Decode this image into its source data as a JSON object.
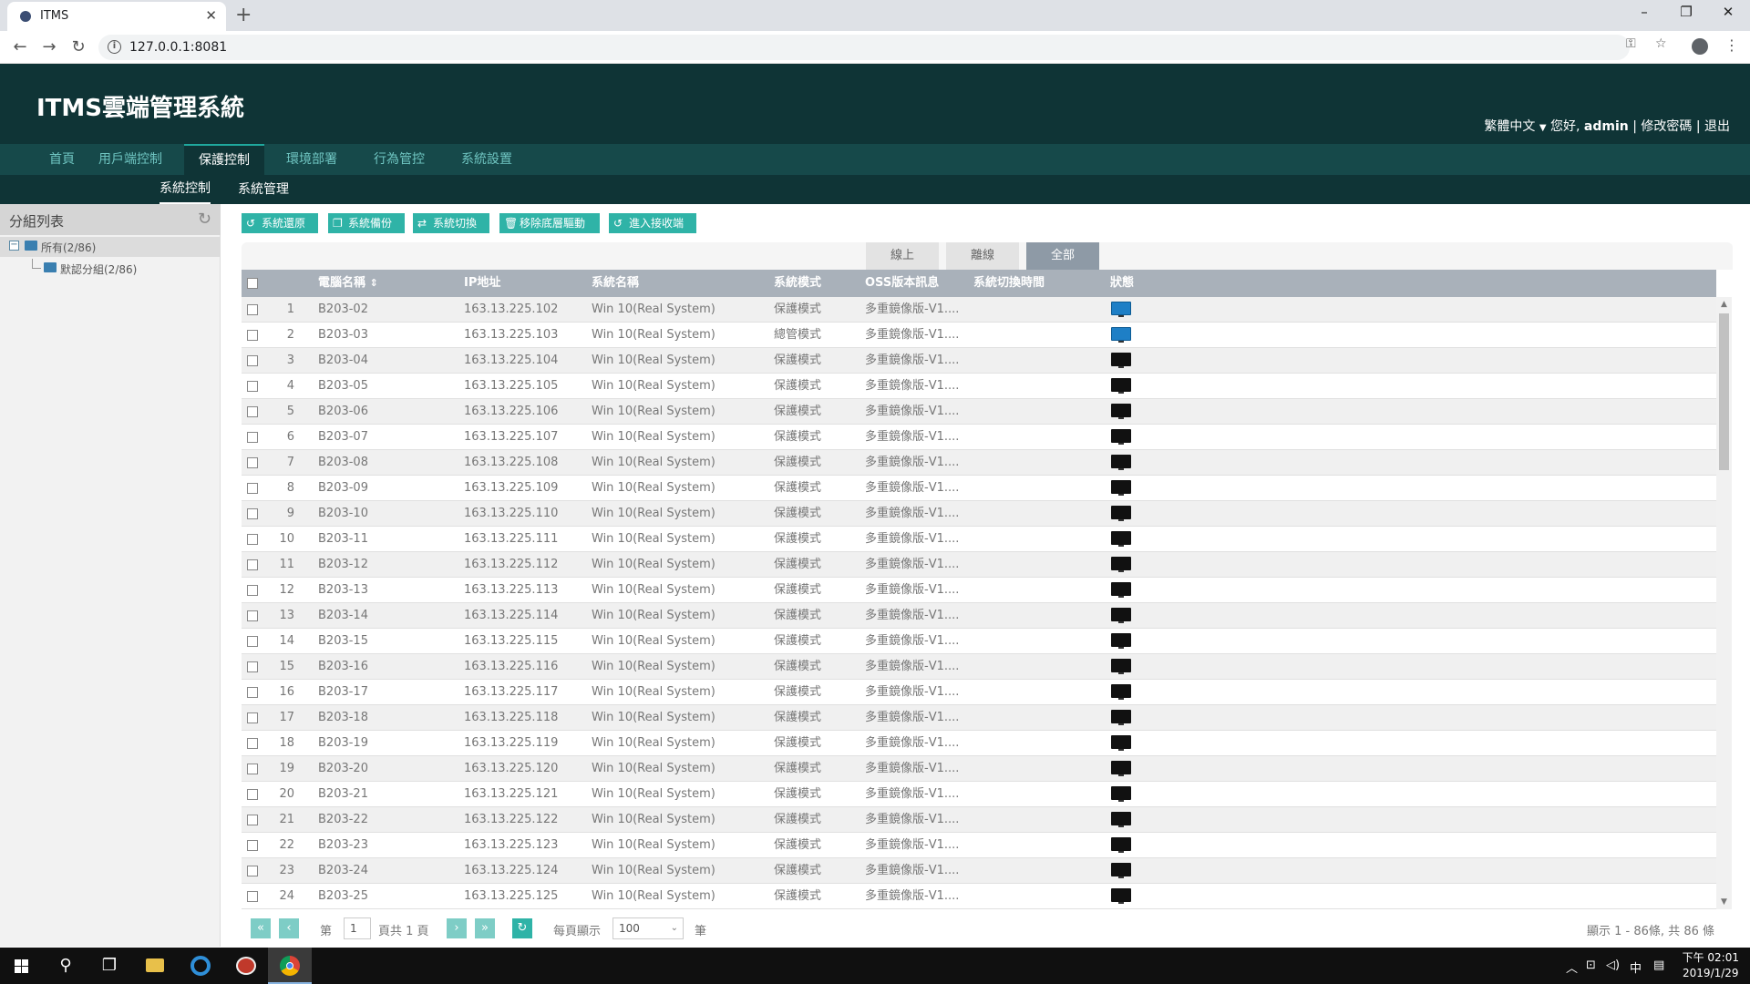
{
  "browser": {
    "tab_title": "ITMS",
    "url": "127.0.0.1:8081"
  },
  "app": {
    "title": "ITMS雲端管理系統",
    "user": {
      "language": "繁體中文",
      "greeting": "您好,",
      "username": "admin",
      "change_password": "修改密碼",
      "logout": "退出",
      "sep": "|"
    }
  },
  "mainnav": [
    "首頁",
    "用戶端控制",
    "保護控制",
    "環境部署",
    "行為管控",
    "系統設置"
  ],
  "mainnav_active": "保護控制",
  "subnav": [
    "系統控制",
    "系統管理"
  ],
  "sidebar": {
    "title": "分組列表",
    "root": "所有(2/86)",
    "child": "默認分組(2/86)"
  },
  "toolbar": [
    "系統還原",
    "系統備份",
    "系統切換",
    "移除底層驅動",
    "進入接收端"
  ],
  "filters": [
    "線上",
    "離線",
    "全部"
  ],
  "filter_active": "全部",
  "table": {
    "columns": [
      "電腦名稱",
      "IP地址",
      "系統名稱",
      "系統模式",
      "OSS版本訊息",
      "系統切換時間",
      "狀態"
    ],
    "rows": [
      {
        "no": "1",
        "name": "B203-02",
        "ip": "163.13.225.102",
        "os": "Win 10(Real System)",
        "mode": "保護模式",
        "oss": "多重鏡像版-V1....",
        "status": "online"
      },
      {
        "no": "2",
        "name": "B203-03",
        "ip": "163.13.225.103",
        "os": "Win 10(Real System)",
        "mode": "總管模式",
        "oss": "多重鏡像版-V1....",
        "status": "online"
      },
      {
        "no": "3",
        "name": "B203-04",
        "ip": "163.13.225.104",
        "os": "Win 10(Real System)",
        "mode": "保護模式",
        "oss": "多重鏡像版-V1....",
        "status": "offline"
      },
      {
        "no": "4",
        "name": "B203-05",
        "ip": "163.13.225.105",
        "os": "Win 10(Real System)",
        "mode": "保護模式",
        "oss": "多重鏡像版-V1....",
        "status": "offline"
      },
      {
        "no": "5",
        "name": "B203-06",
        "ip": "163.13.225.106",
        "os": "Win 10(Real System)",
        "mode": "保護模式",
        "oss": "多重鏡像版-V1....",
        "status": "offline"
      },
      {
        "no": "6",
        "name": "B203-07",
        "ip": "163.13.225.107",
        "os": "Win 10(Real System)",
        "mode": "保護模式",
        "oss": "多重鏡像版-V1....",
        "status": "offline"
      },
      {
        "no": "7",
        "name": "B203-08",
        "ip": "163.13.225.108",
        "os": "Win 10(Real System)",
        "mode": "保護模式",
        "oss": "多重鏡像版-V1....",
        "status": "offline"
      },
      {
        "no": "8",
        "name": "B203-09",
        "ip": "163.13.225.109",
        "os": "Win 10(Real System)",
        "mode": "保護模式",
        "oss": "多重鏡像版-V1....",
        "status": "offline"
      },
      {
        "no": "9",
        "name": "B203-10",
        "ip": "163.13.225.110",
        "os": "Win 10(Real System)",
        "mode": "保護模式",
        "oss": "多重鏡像版-V1....",
        "status": "offline"
      },
      {
        "no": "10",
        "name": "B203-11",
        "ip": "163.13.225.111",
        "os": "Win 10(Real System)",
        "mode": "保護模式",
        "oss": "多重鏡像版-V1....",
        "status": "offline"
      },
      {
        "no": "11",
        "name": "B203-12",
        "ip": "163.13.225.112",
        "os": "Win 10(Real System)",
        "mode": "保護模式",
        "oss": "多重鏡像版-V1....",
        "status": "offline"
      },
      {
        "no": "12",
        "name": "B203-13",
        "ip": "163.13.225.113",
        "os": "Win 10(Real System)",
        "mode": "保護模式",
        "oss": "多重鏡像版-V1....",
        "status": "offline"
      },
      {
        "no": "13",
        "name": "B203-14",
        "ip": "163.13.225.114",
        "os": "Win 10(Real System)",
        "mode": "保護模式",
        "oss": "多重鏡像版-V1....",
        "status": "offline"
      },
      {
        "no": "14",
        "name": "B203-15",
        "ip": "163.13.225.115",
        "os": "Win 10(Real System)",
        "mode": "保護模式",
        "oss": "多重鏡像版-V1....",
        "status": "offline"
      },
      {
        "no": "15",
        "name": "B203-16",
        "ip": "163.13.225.116",
        "os": "Win 10(Real System)",
        "mode": "保護模式",
        "oss": "多重鏡像版-V1....",
        "status": "offline"
      },
      {
        "no": "16",
        "name": "B203-17",
        "ip": "163.13.225.117",
        "os": "Win 10(Real System)",
        "mode": "保護模式",
        "oss": "多重鏡像版-V1....",
        "status": "offline"
      },
      {
        "no": "17",
        "name": "B203-18",
        "ip": "163.13.225.118",
        "os": "Win 10(Real System)",
        "mode": "保護模式",
        "oss": "多重鏡像版-V1....",
        "status": "offline"
      },
      {
        "no": "18",
        "name": "B203-19",
        "ip": "163.13.225.119",
        "os": "Win 10(Real System)",
        "mode": "保護模式",
        "oss": "多重鏡像版-V1....",
        "status": "offline"
      },
      {
        "no": "19",
        "name": "B203-20",
        "ip": "163.13.225.120",
        "os": "Win 10(Real System)",
        "mode": "保護模式",
        "oss": "多重鏡像版-V1....",
        "status": "offline"
      },
      {
        "no": "20",
        "name": "B203-21",
        "ip": "163.13.225.121",
        "os": "Win 10(Real System)",
        "mode": "保護模式",
        "oss": "多重鏡像版-V1....",
        "status": "offline"
      },
      {
        "no": "21",
        "name": "B203-22",
        "ip": "163.13.225.122",
        "os": "Win 10(Real System)",
        "mode": "保護模式",
        "oss": "多重鏡像版-V1....",
        "status": "offline"
      },
      {
        "no": "22",
        "name": "B203-23",
        "ip": "163.13.225.123",
        "os": "Win 10(Real System)",
        "mode": "保護模式",
        "oss": "多重鏡像版-V1....",
        "status": "offline"
      },
      {
        "no": "23",
        "name": "B203-24",
        "ip": "163.13.225.124",
        "os": "Win 10(Real System)",
        "mode": "保護模式",
        "oss": "多重鏡像版-V1....",
        "status": "offline"
      },
      {
        "no": "24",
        "name": "B203-25",
        "ip": "163.13.225.125",
        "os": "Win 10(Real System)",
        "mode": "保護模式",
        "oss": "多重鏡像版-V1....",
        "status": "offline"
      }
    ]
  },
  "status_colors": {
    "online": "#1e7fc6",
    "offline": "#111111"
  },
  "pager": {
    "page_prefix": "第",
    "page": "1",
    "page_suffix": "頁共 1 頁",
    "per_page_label": "每頁顯示",
    "per_page": "100",
    "unit": "筆",
    "summary": "顯示 1 - 86條, 共 86 條"
  },
  "taskbar": {
    "ime": "中",
    "time": "下午 02:01",
    "date": "2019/1/29"
  },
  "icons": {
    "tab_close": "✕",
    "new_tab": "+",
    "minimize": "–",
    "restore": "❐",
    "close": "✕",
    "back": "←",
    "forward": "→",
    "reload": "↻",
    "key": "⚿",
    "star": "☆",
    "menu": "⋮",
    "refresh": "↻",
    "sort": "⇕",
    "dropdown": "▼",
    "first": "«",
    "prev": "‹",
    "next": "›",
    "last": "»",
    "pg_refresh": "↻",
    "select_arrow": "⌄",
    "scroll_up": "▲",
    "scroll_down": "▼",
    "search": "⚲",
    "taskview": "❐",
    "tray_up": "︿",
    "network": "⊡",
    "volume": "◁)",
    "notify": "▤",
    "toolbar": [
      "↺",
      "❐",
      "⇄",
      "🗑",
      "↺"
    ]
  }
}
